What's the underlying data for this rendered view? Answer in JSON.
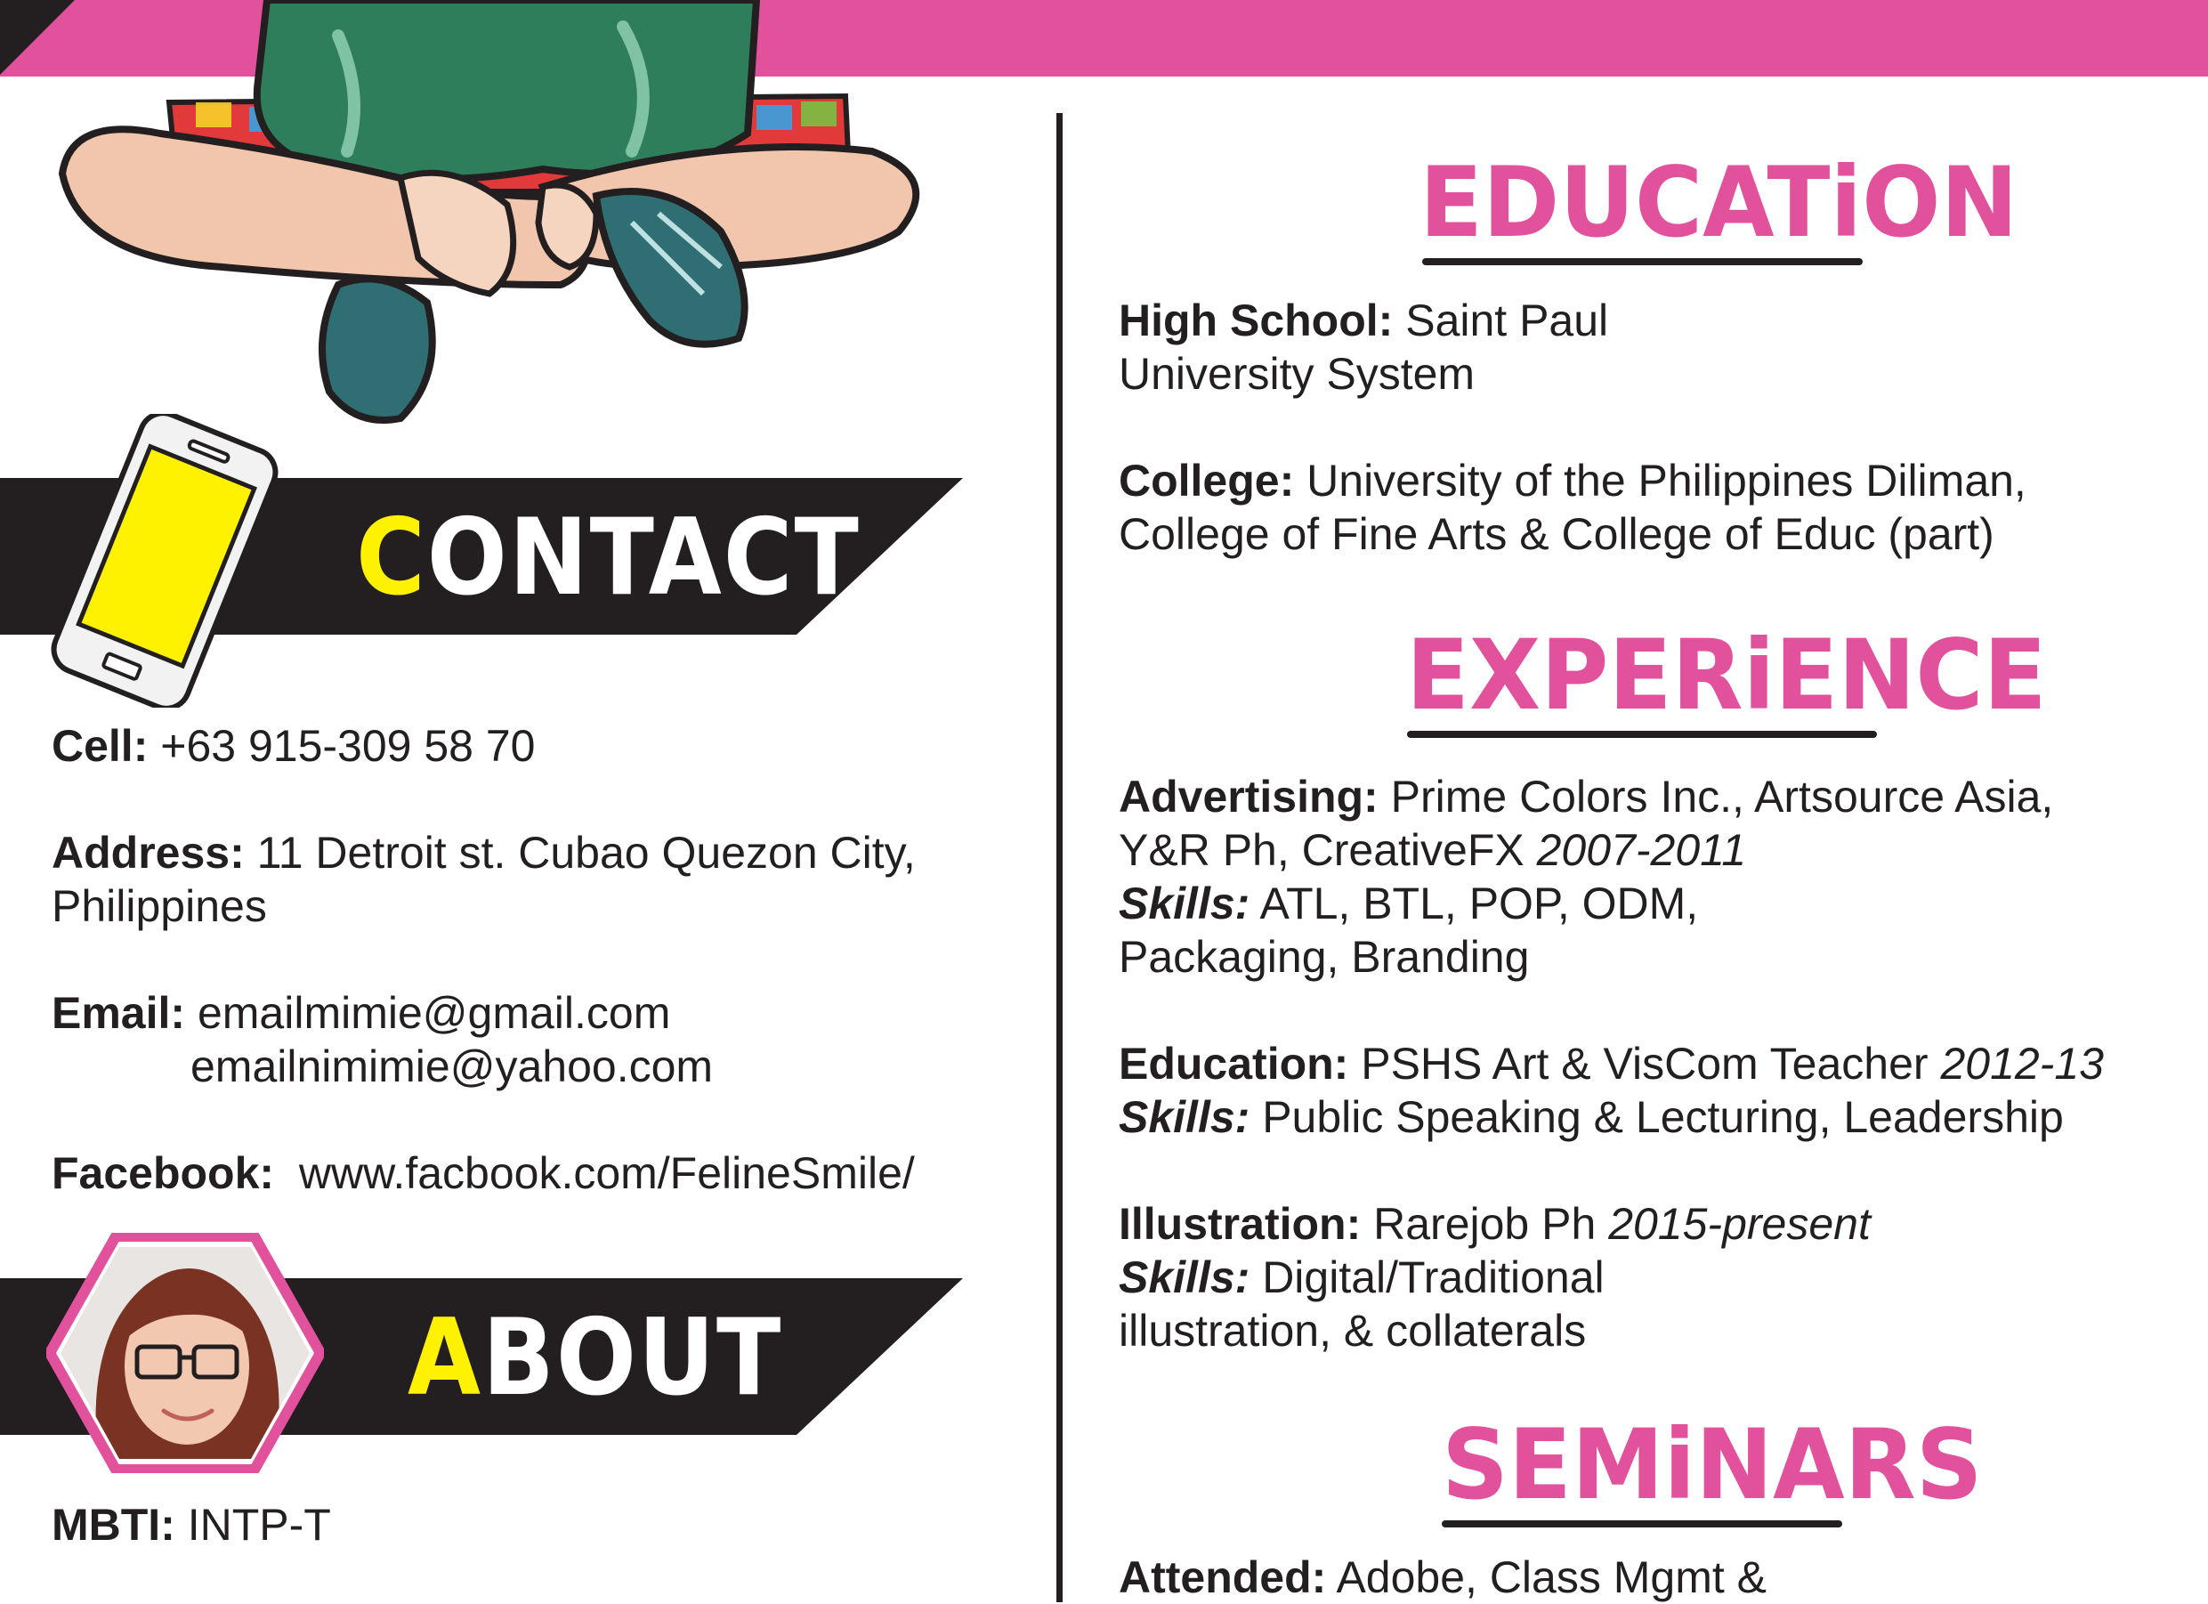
{
  "colors": {
    "accent": "#e2519b",
    "dark": "#231f20",
    "highlight": "#fff200"
  },
  "contact": {
    "title_first": "C",
    "title_rest": "ONTACT",
    "cell_label": "Cell:",
    "cell_value": "+63 915-309 58 70",
    "address_label": "Address:",
    "address_line1": "11 Detroit st. Cubao Quezon City,",
    "address_line2": "Philippines",
    "email_label": "Email:",
    "email_1": "emailmimie@gmail.com",
    "email_2": "emailnimimie@yahoo.com",
    "facebook_label": "Facebook:",
    "facebook_value": "www.facbook.com/FelineSmile/"
  },
  "about": {
    "title_first": "A",
    "title_rest": "BOUT",
    "mbti_label": "MBTI:",
    "mbti_value": "INTP-T"
  },
  "education": {
    "title": "EDUCATiON",
    "high_school_label": "High School:",
    "high_school_line1": "Saint Paul",
    "high_school_line2": "University System",
    "college_label": "College:",
    "college_line1": "University of the Philippines Diliman,",
    "college_line2": "College of Fine Arts & College of Educ (part)"
  },
  "experience": {
    "title": "EXPERiENCE",
    "entries": [
      {
        "label": "Advertising:",
        "line1": "Prime Colors Inc., Artsource Asia,",
        "line2": "Y&R Ph, CreativeFX",
        "years": "2007-2011",
        "skills_label": "Skills:",
        "skills_line1": "ATL, BTL, POP, ODM,",
        "skills_line2": "Packaging, Branding"
      },
      {
        "label": "Education:",
        "line1": "PSHS Art & VisCom Teacher",
        "years": "2012-13",
        "skills_label": "Skills:",
        "skills_line1": "Public Speaking & Lecturing, Leadership"
      },
      {
        "label": "Illustration:",
        "line1": "Rarejob Ph",
        "years": "2015-present",
        "skills_label": "Skills:",
        "skills_line1": "Digital/Traditional",
        "skills_line2": "illustration, & collaterals"
      }
    ]
  },
  "seminars": {
    "title": "SEMiNARS",
    "attended_label": "Attended:",
    "attended_value": "Adobe,  Class Mgmt &"
  }
}
